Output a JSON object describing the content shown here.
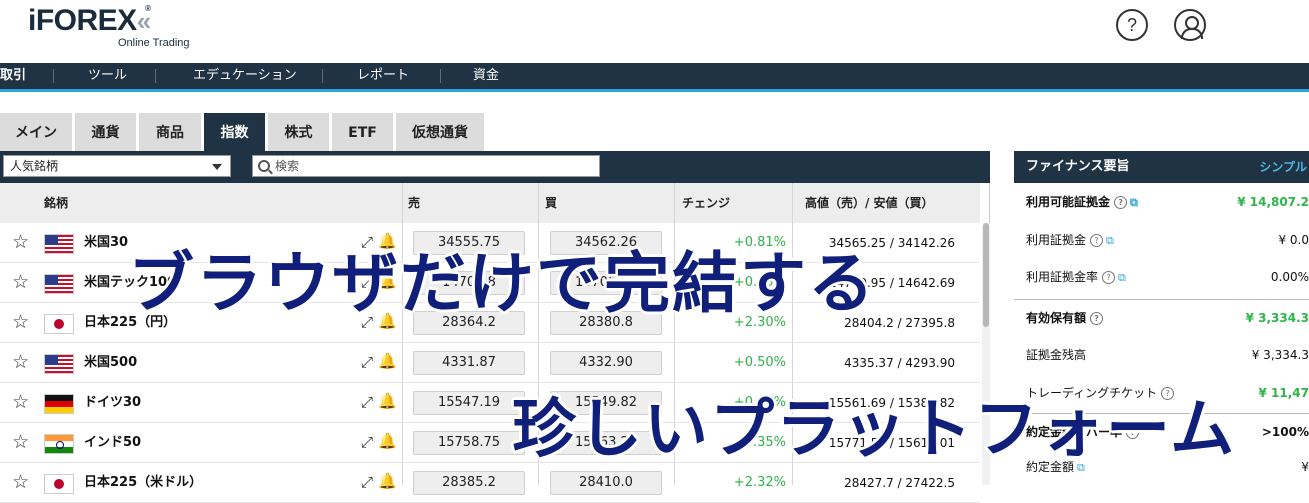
{
  "header": {
    "logo_text": "iFOREX",
    "logo_chevrons": "«",
    "logo_reg": "®",
    "logo_sub": "Online Trading",
    "help_glyph": "?",
    "icons": [
      "help-icon",
      "user-icon"
    ]
  },
  "nav": {
    "items": [
      "取引",
      "ツール",
      "エデュケーション",
      "レポート",
      "資金"
    ]
  },
  "tabs": [
    "メイン",
    "通貨",
    "商品",
    "指数",
    "株式",
    "ETF",
    "仮想通貨"
  ],
  "active_tab": "指数",
  "filter": {
    "selected": "人気銘柄",
    "search_placeholder": "検索"
  },
  "columns": {
    "instrument": "銘柄",
    "sell": "売",
    "buy": "買",
    "change": "チェンジ",
    "high_low": "高値（売）/ 安値（買）"
  },
  "rows": [
    {
      "flag": "us",
      "name": "米国30",
      "sell": "34555.75",
      "buy": "34562.26",
      "change": "+0.81%",
      "high_low": "34565.25 / 34142.26"
    },
    {
      "flag": "us",
      "name": "米国テック100",
      "sell": "14700.8",
      "buy": "14705.44",
      "change": "+0.09%",
      "high_low": "14740.95 / 14642.69"
    },
    {
      "flag": "jp",
      "name": "日本225（円）",
      "sell": "28364.2",
      "buy": "28380.8",
      "change": "+2.30%",
      "high_low": "28404.2 / 27395.8"
    },
    {
      "flag": "us",
      "name": "米国500",
      "sell": "4331.87",
      "buy": "4332.90",
      "change": "+0.50%",
      "high_low": "4335.37 / 4293.90"
    },
    {
      "flag": "de",
      "name": "ドイツ30",
      "sell": "15547.19",
      "buy": "15549.82",
      "change": "+0.95%",
      "high_low": "15561.69 / 15384.82"
    },
    {
      "flag": "in",
      "name": "インド50",
      "sell": "15758.75",
      "buy": "15763.25",
      "change": "+0.35%",
      "high_low": "15771.50 / 15618.01"
    },
    {
      "flag": "jp",
      "name": "日本225（米ドル）",
      "sell": "28385.2",
      "buy": "28410.0",
      "change": "+2.32%",
      "high_low": "28427.7 / 27422.5"
    }
  ],
  "finance": {
    "title": "ファイナンス要旨",
    "simple_label": "シンプル",
    "items": [
      {
        "label": "利用可能証拠金",
        "value": "¥ 14,807.2"
      },
      {
        "label": "利用証拠金",
        "value": "¥ 0.0"
      },
      {
        "label": "利用証拠金率",
        "value": "0.00%"
      },
      {
        "label": "有効保有額",
        "value": "¥ 3,334.3"
      },
      {
        "label": "証拠金残高",
        "value": "¥ 3,334.3"
      },
      {
        "label": "トレーディングチケット",
        "value": "¥ 11,47"
      },
      {
        "label": "約定金額カバー率",
        "value": ">100%"
      },
      {
        "label": "約定金額",
        "value": "¥"
      }
    ]
  },
  "overlay": {
    "line1": "ブラウザだけで完結する",
    "line2": "珍しいプラットフォーム"
  },
  "colors": {
    "navy": "#1f3344",
    "accent": "#2ba3df",
    "positive": "#2fb34a",
    "overlay_text": "#0f1f7a"
  }
}
